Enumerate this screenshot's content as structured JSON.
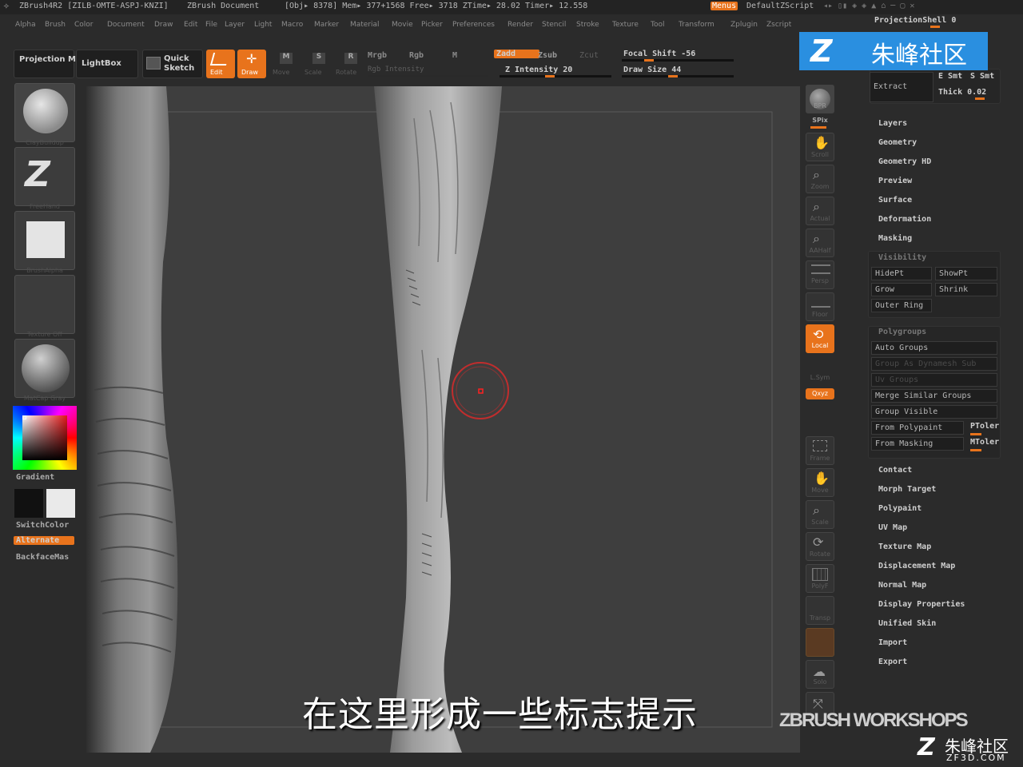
{
  "titlebar": {
    "app": "ZBrush4R2 [ZILB-OMTE-ASPJ-KNZI]",
    "document": "ZBrush Document",
    "stats": "[Obj▸ 8378] Mem▸ 377+1568 Free▸ 3718 ZTime▸ 28.02 Timer▸ 12.558",
    "menus_btn": "Menus",
    "script": "DefaultZScript"
  },
  "menubar": [
    "Alpha",
    "Brush",
    "Color",
    "Document",
    "Draw",
    "Edit",
    "File",
    "Layer",
    "Light",
    "Macro",
    "Marker",
    "Material",
    "Movie",
    "Picker",
    "Preferences",
    "Render",
    "Stencil",
    "Stroke",
    "Texture",
    "Tool",
    "Transform",
    "Zplugin",
    "Zscript"
  ],
  "toolbar": {
    "projection_master": "Projection Master",
    "lightbox": "LightBox",
    "quick_sketch": "Quick Sketch",
    "edit": "Edit",
    "draw": "Draw",
    "move": "Move",
    "scale": "Scale",
    "rotate": "Rotate",
    "mrgb": "Mrgb",
    "rgb": "Rgb",
    "m": "M",
    "rgb_intensity": "Rgb Intensity",
    "zadd": "Zadd",
    "zsub": "Zsub",
    "zcut": "Zcut",
    "z_intensity": "Z Intensity 20",
    "focal_shift": "Focal Shift -56",
    "draw_size": "Draw Size 44"
  },
  "left_shelf": {
    "brush": "ClayBuildup",
    "stroke": "FreeHand",
    "alpha": "BrushAlpha",
    "texture": "Texture Off",
    "material": "MatCap Gray",
    "gradient": "Gradient",
    "switch_color": "SwitchColor",
    "alternate": "Alternate",
    "backface": "BackfaceMas"
  },
  "right_shelf": {
    "bpr": "BPR",
    "spix": "SPix",
    "scroll": "Scroll",
    "zoom": "Zoom",
    "actual": "Actual",
    "aahalf": "AAHalf",
    "persp": "Persp",
    "floor": "Floor",
    "local": "Local",
    "lsym": "L.Sym",
    "xyz": "Qxyz",
    "frame": "Frame",
    "move": "Move",
    "scale": "Scale",
    "rotate": "Rotate",
    "polyf": "PolyF",
    "transp": "Transp",
    "solo": "Solo"
  },
  "panel": {
    "projection_shell": "ProjectionShell 0",
    "extract": "Extract",
    "e_smt": "E Smt",
    "s_smt": "S Smt",
    "thick": "Thick 0.02",
    "sections_top": [
      "Layers",
      "Geometry",
      "Geometry HD",
      "Preview",
      "Surface",
      "Deformation",
      "Masking"
    ],
    "visibility": {
      "title": "Visibility",
      "hidept": "HidePt",
      "showpt": "ShowPt",
      "grow": "Grow",
      "shrink": "Shrink",
      "outer_ring": "Outer Ring"
    },
    "polygroups": {
      "title": "Polygroups",
      "auto_groups": "Auto Groups",
      "group_as_dynamesh": "Group As Dynamesh Sub",
      "uv_groups": "Uv Groups",
      "merge_similar": "Merge Similar Groups",
      "group_visible": "Group Visible",
      "from_polypaint": "From Polypaint",
      "ptoler": "PToler",
      "from_masking": "From Masking",
      "mtoler": "MToler"
    },
    "sections_bottom": [
      "Contact",
      "Morph Target",
      "Polypaint",
      "UV Map",
      "Texture Map",
      "Displacement Map",
      "Normal Map",
      "Display Properties",
      "Unified Skin",
      "Import",
      "Export"
    ]
  },
  "watermark": {
    "top": "朱峰社区",
    "bottom": "朱峰社区",
    "bottom_url": "ZF3D.COM",
    "workshops": "ZBRUSH WORKSHOPS"
  },
  "subtitle": "在这里形成一些标志提示"
}
